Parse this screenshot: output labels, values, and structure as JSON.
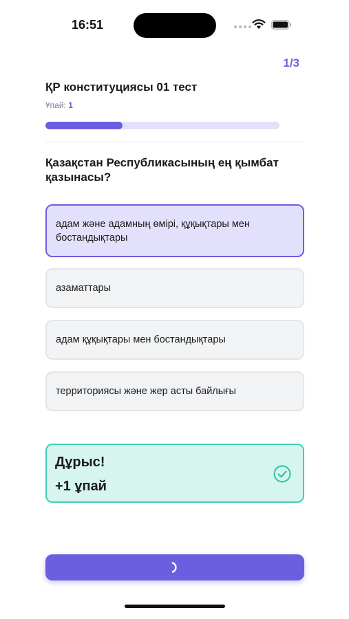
{
  "status_bar": {
    "time": "16:51"
  },
  "quiz": {
    "page_counter": "1/3",
    "title": "ҚР конституциясы 01 тест",
    "score_label": "Ұпай:",
    "score_value": "1",
    "progress_fraction": 0.33,
    "question": "Қазақстан Республикасының ең қымбат қазынасы?",
    "options": [
      {
        "label": "адам және адамның өмірі, құқықтары мен бостандықтары",
        "selected": true
      },
      {
        "label": "азаматтары",
        "selected": false
      },
      {
        "label": "адам құқықтары мен бостандықтары",
        "selected": false
      },
      {
        "label": "территориясы және жер асты байлығы",
        "selected": false
      }
    ]
  },
  "feedback": {
    "title": "Дұрыс!",
    "points": "+1 ұпай",
    "icon": "check-circle-icon"
  },
  "next_button": {
    "icon": "spinner-icon"
  },
  "colors": {
    "accent": "#6b5fe0",
    "accent_light": "#e3e0fc",
    "success_border": "#3fcfb6",
    "success_bg": "#d6f5ee",
    "option_bg": "#f1f3f5"
  }
}
